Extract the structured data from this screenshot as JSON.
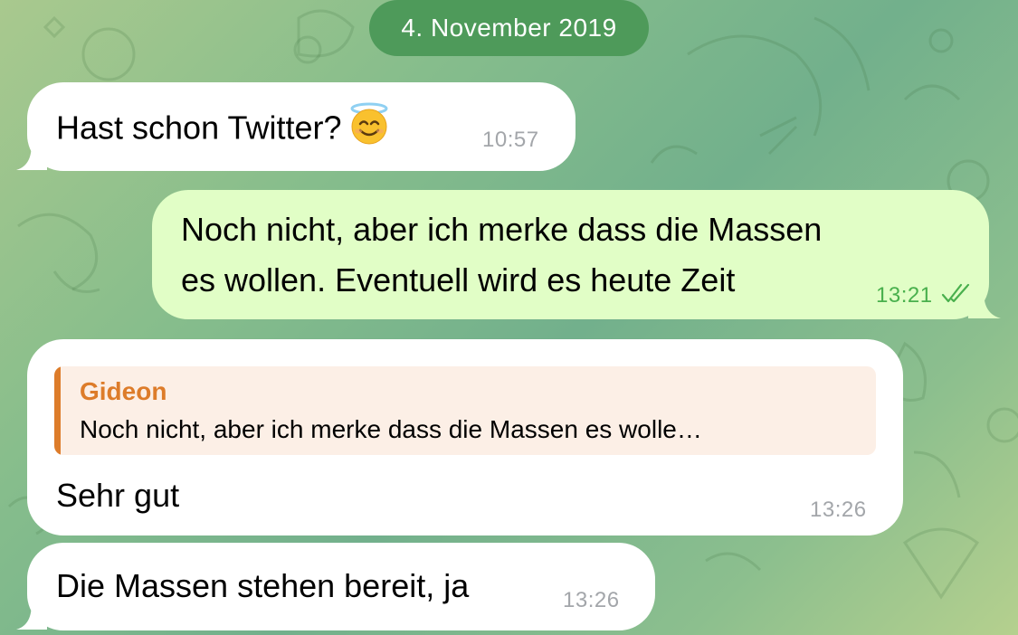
{
  "date_separator": "4. November 2019",
  "messages": [
    {
      "direction": "incoming",
      "text": "Hast schon Twitter?",
      "emoji": "smiling-face-with-halo",
      "time": "10:57"
    },
    {
      "direction": "outgoing",
      "lines": [
        "Noch nicht, aber ich merke dass die Massen",
        "es wollen. Eventuell wird es heute Zeit"
      ],
      "time": "13:21",
      "status": "read"
    },
    {
      "direction": "incoming",
      "reply": {
        "name": "Gideon",
        "text": "Noch nicht, aber ich merke dass die Massen es wolle…"
      },
      "text": "Sehr gut",
      "time": "13:26"
    },
    {
      "direction": "incoming",
      "text": "Die Massen stehen bereit, ja",
      "time": "13:26"
    }
  ],
  "colors": {
    "date_pill": "#4e9a5a",
    "incoming_bubble": "#ffffff",
    "outgoing_bubble": "#e1fec6",
    "outgoing_time": "#49b04d",
    "reply_accent": "#dd7c2a",
    "reply_background": "#fcefe6"
  }
}
